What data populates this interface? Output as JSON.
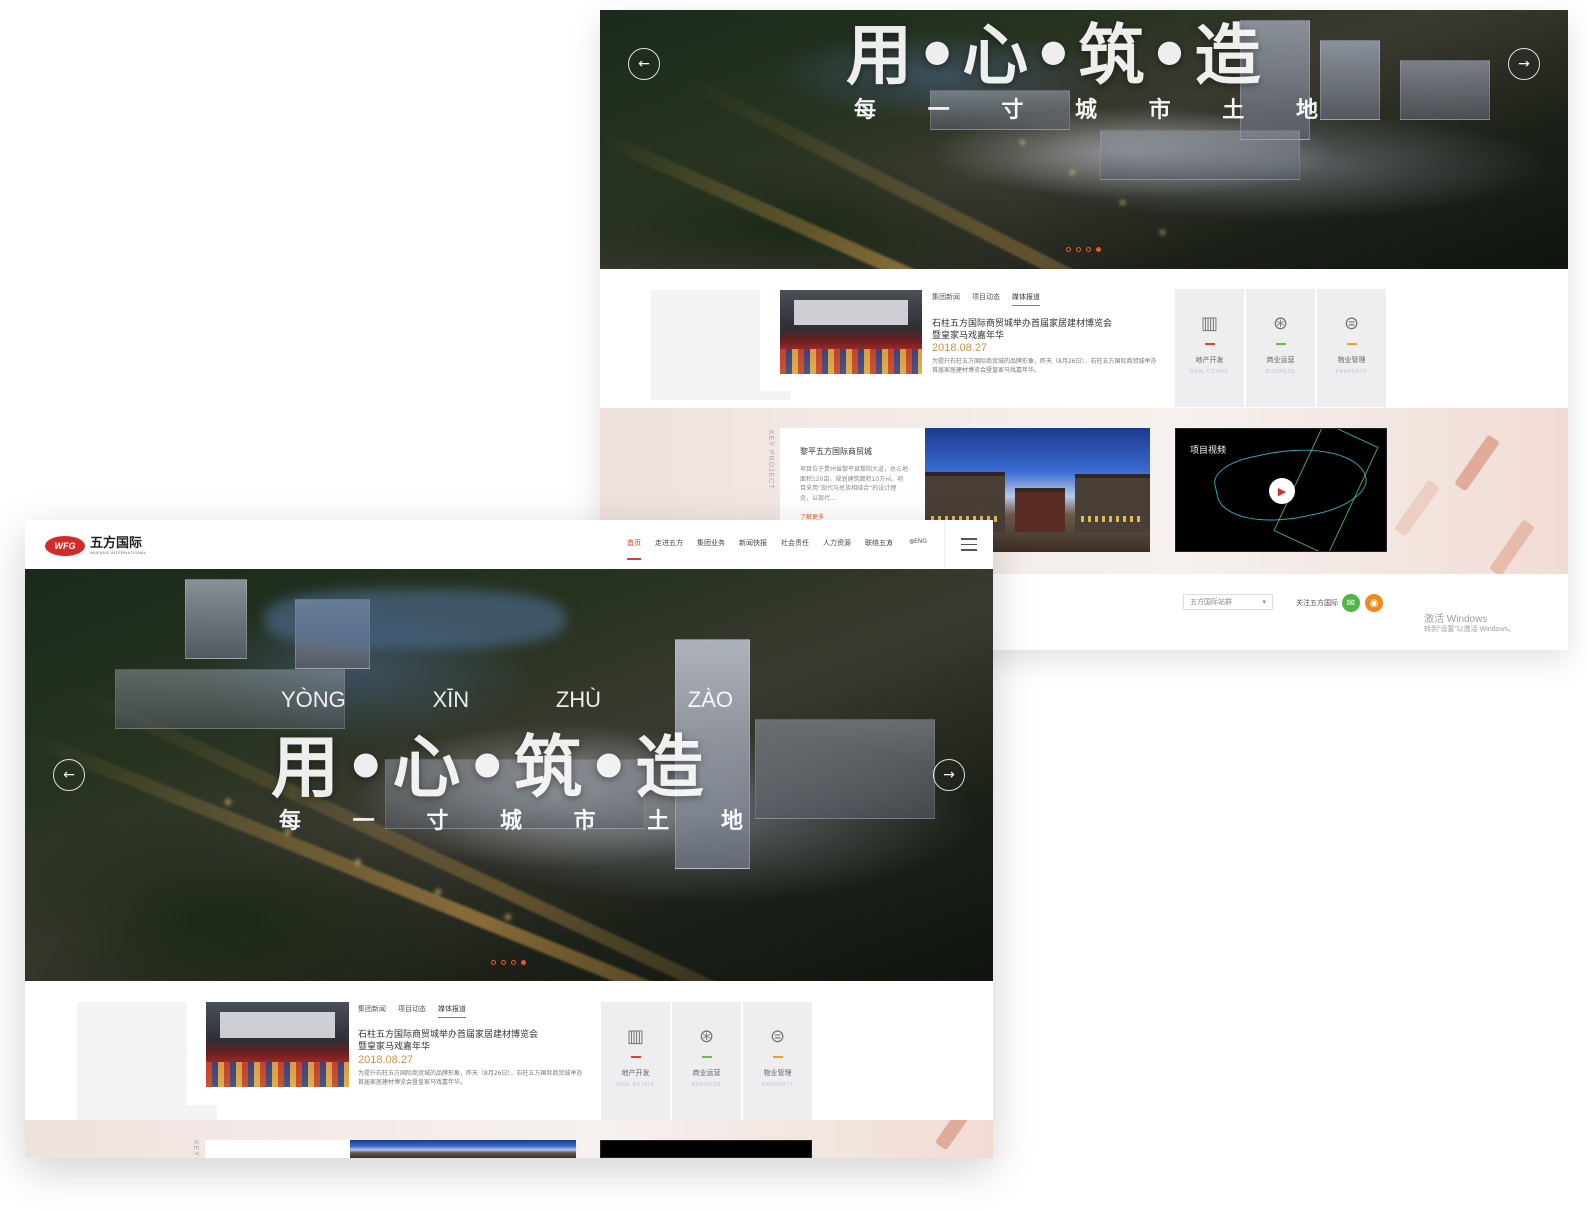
{
  "hero": {
    "title_chars": [
      "用",
      "•",
      "心",
      "•",
      "筑",
      "•",
      "造"
    ],
    "pinyin": [
      "YÒNG",
      "XĪN",
      "ZHÙ",
      "ZÀO"
    ],
    "subtitle_chars": [
      "每",
      "一",
      "寸",
      "城",
      "市",
      "土",
      "地"
    ],
    "prev_icon": "arrow-left-icon",
    "next_icon": "arrow-right-icon",
    "slide_count": 4,
    "active_slide": 4
  },
  "nav": {
    "logo_mark": "WFG",
    "logo_cn": "五方国际",
    "logo_en": "WUFANG INTERNATIONAL",
    "items": [
      "首页",
      "走进五方",
      "集团业务",
      "新闻快报",
      "社会责任",
      "人力资源",
      "联络五方"
    ],
    "active_index": 0,
    "search_icon": "search-icon",
    "lang_label": "ENG",
    "menu_icon": "hamburger-menu-icon"
  },
  "news": {
    "tabs": [
      "集团新闻",
      "项目动态",
      "媒体报道"
    ],
    "active_tab": 2,
    "title": "石柱五方国际商贸城举办首届家居建材博览会暨皇家马戏嘉年华",
    "date": "2018.08.27",
    "desc": "为提升石柱五方国际商贸城的品牌形象，昨天（8月26日），石柱五方国际商贸城举办首届家居建材博览会暨皇家马戏嘉年华。"
  },
  "business": [
    {
      "icon": "building-icon",
      "label": "地产开发",
      "en": "REAL ESTATE",
      "color": "#e0402d"
    },
    {
      "icon": "handshake-icon",
      "label": "商业运营",
      "en": "BUSINESS",
      "color": "#6bbf3a"
    },
    {
      "icon": "property-management-icon",
      "label": "物业管理",
      "en": "PROPERTY",
      "color": "#f0a21e"
    }
  ],
  "key_project": {
    "label": "KEY PROJECT",
    "title": "黎平五方国际商贸城",
    "desc": "项目位于贵州省黎平县黎阳大道，总占地面积120亩，规划建筑面积10万㎡。项目采用“现代与民族相结合”的设计理念，以现代...",
    "more": "了解更多",
    "video_title": "项目视频",
    "play_icon": "play-icon"
  },
  "footer": {
    "site_group": "五方国际站群",
    "follow": "关注五方国际",
    "wechat_icon": "wechat-icon",
    "weibo_icon": "weibo-icon"
  },
  "watermark": {
    "line1": "激活 Windows",
    "line2": "转到“设置”以激活 Windows。"
  },
  "colors": {
    "accent": "#e8582b",
    "nav_active": "#e03a2a",
    "date": "#c8944a"
  }
}
